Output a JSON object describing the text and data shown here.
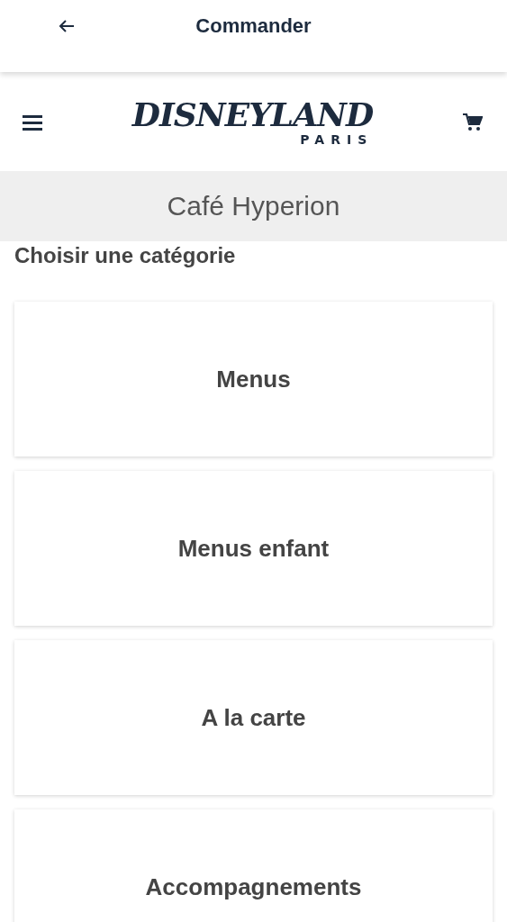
{
  "top_bar": {
    "title": "Commander"
  },
  "header": {
    "logo_main": "DISNEYLAND",
    "logo_sub": "PARIS"
  },
  "restaurant": {
    "name": "Café Hyperion"
  },
  "section_heading": "Choisir une catégorie",
  "categories": [
    {
      "label": "Menus"
    },
    {
      "label": "Menus enfant"
    },
    {
      "label": "A la carte"
    },
    {
      "label": "Accompagnements"
    }
  ]
}
